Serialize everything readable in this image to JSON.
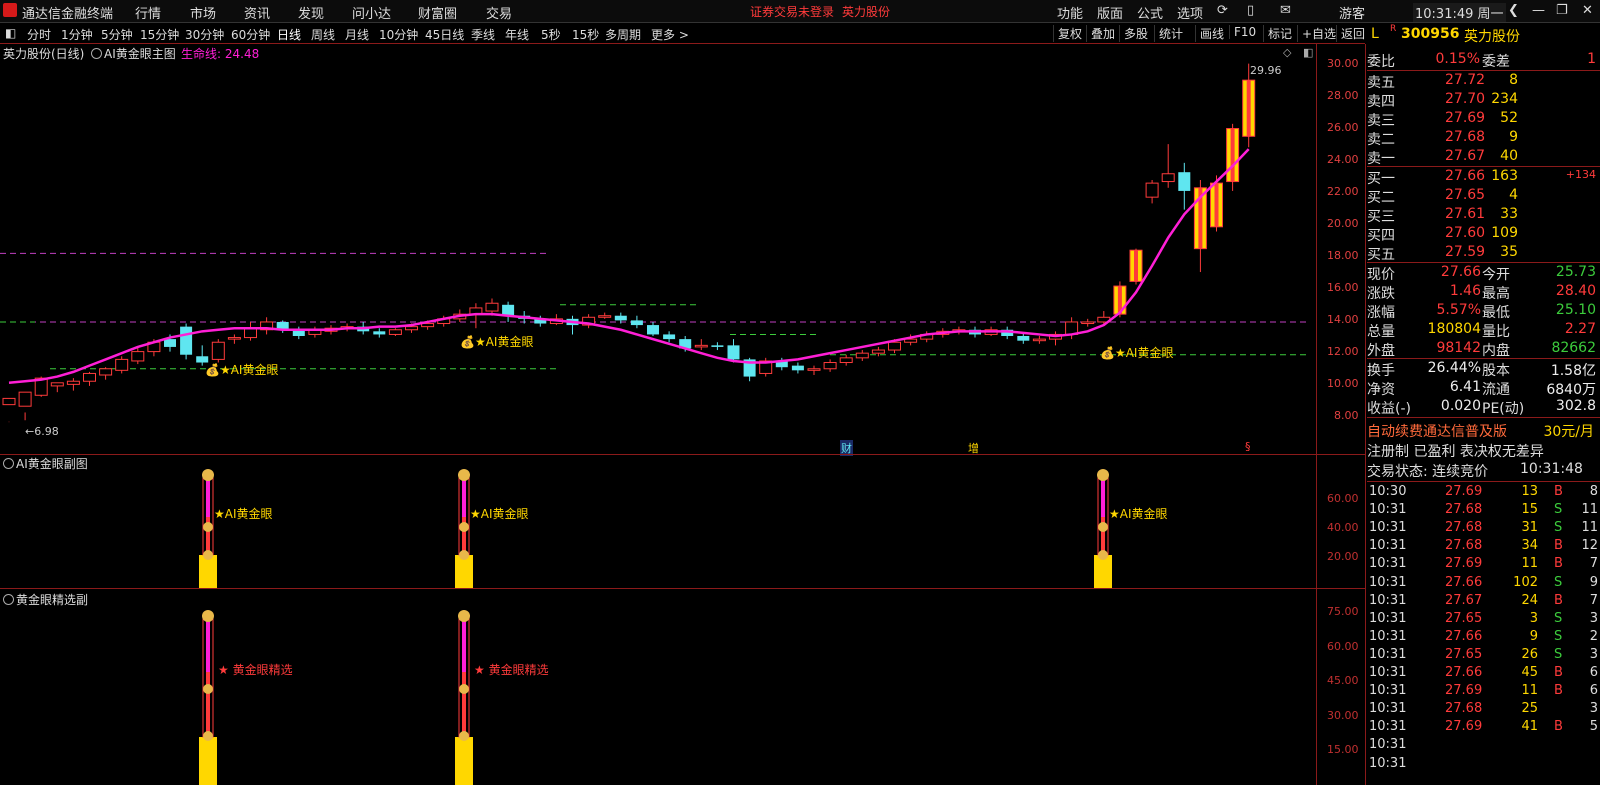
{
  "app": {
    "title": "通达信金融终端"
  },
  "menu": {
    "items": [
      "行情",
      "市场",
      "资讯",
      "发现",
      "问小达",
      "财富圈",
      "交易"
    ],
    "warning": "证券交易未登录",
    "stock_name": "英力股份",
    "right_items": [
      "功能",
      "版面",
      "公式",
      "选项"
    ],
    "user": "游客",
    "clock": "10:31:49 周一"
  },
  "periods": [
    "分时",
    "1分钟",
    "5分钟",
    "15分钟",
    "30分钟",
    "60分钟",
    "日线",
    "周线",
    "月线",
    "10分钟",
    "45日线",
    "季线",
    "年线",
    "5秒",
    "15秒",
    "多周期",
    "更多 >"
  ],
  "tools": [
    "复权",
    "叠加",
    "多股",
    "统计",
    "画线",
    "F10",
    "标记",
    "+自选",
    "返回"
  ],
  "main_panel": {
    "title": "英力股份(日线)",
    "indicator": "AI黄金眼主图",
    "lifeline_label": "生命线: 24.48",
    "y_ticks": [
      "30.00",
      "28.00",
      "26.00",
      "24.00",
      "22.00",
      "20.00",
      "18.00",
      "16.00",
      "14.00",
      "12.00",
      "10.00",
      "8.00"
    ],
    "high_label": "29.96",
    "low_label": "6.98",
    "signal_label": "AI黄金眼",
    "markers": [
      "财",
      "增",
      "§"
    ]
  },
  "sub1": {
    "title": "AI黄金眼副图",
    "y_ticks": [
      "60.00",
      "40.00",
      "20.00"
    ],
    "signal_label": "AI黄金眼"
  },
  "sub2": {
    "title": "黄金眼精选副",
    "y_ticks": [
      "75.00",
      "60.00",
      "45.00",
      "30.00",
      "15.00"
    ],
    "signal_label": "黄金眼精选"
  },
  "quote": {
    "market": "L",
    "r_badge": "R",
    "code": "300956",
    "name": "英力股份",
    "weibi_label": "委比",
    "weibi": "0.15%",
    "weicha_label": "委差",
    "weicha": "1",
    "sell": [
      {
        "label": "卖五",
        "price": "27.72",
        "vol": "8"
      },
      {
        "label": "卖四",
        "price": "27.70",
        "vol": "234"
      },
      {
        "label": "卖三",
        "price": "27.69",
        "vol": "52"
      },
      {
        "label": "卖二",
        "price": "27.68",
        "vol": "9"
      },
      {
        "label": "卖一",
        "price": "27.67",
        "vol": "40"
      }
    ],
    "buy": [
      {
        "label": "买一",
        "price": "27.66",
        "vol": "163",
        "chg": "+134"
      },
      {
        "label": "买二",
        "price": "27.65",
        "vol": "4",
        "chg": ""
      },
      {
        "label": "买三",
        "price": "27.61",
        "vol": "33",
        "chg": ""
      },
      {
        "label": "买四",
        "price": "27.60",
        "vol": "109",
        "chg": ""
      },
      {
        "label": "买五",
        "price": "27.59",
        "vol": "35",
        "chg": ""
      }
    ],
    "stats": [
      {
        "l1": "现价",
        "v1": "27.66",
        "l2": "今开",
        "v2": "25.73",
        "c1": "red",
        "c2": "green"
      },
      {
        "l1": "涨跌",
        "v1": "1.46",
        "l2": "最高",
        "v2": "28.40",
        "c1": "red",
        "c2": "red"
      },
      {
        "l1": "涨幅",
        "v1": "5.57%",
        "l2": "最低",
        "v2": "25.10",
        "c1": "red",
        "c2": "green"
      },
      {
        "l1": "总量",
        "v1": "180804",
        "l2": "量比",
        "v2": "2.27",
        "c1": "yellow",
        "c2": "red"
      },
      {
        "l1": "外盘",
        "v1": "98142",
        "l2": "内盘",
        "v2": "82662",
        "c1": "red",
        "c2": "green"
      }
    ],
    "stats2": [
      {
        "l1": "换手",
        "v1": "26.44%",
        "l2": "股本",
        "v2": "1.58亿"
      },
      {
        "l1": "净资",
        "v1": "6.41",
        "l2": "流通",
        "v2": "6840万"
      },
      {
        "l1": "收益(-)",
        "v1": "0.020",
        "l2": "PE(动)",
        "v2": "302.8"
      }
    ],
    "ad1": "自动续费通达信普及版",
    "ad1_price": "30元/月",
    "ad2": "注册制 已盈利 表决权无差异",
    "status_label": "交易状态: 连续竞价",
    "status_time": "10:31:48",
    "ticks": [
      {
        "t": "10:30",
        "p": "27.69",
        "v": "13",
        "s": "B",
        "n": "8"
      },
      {
        "t": "10:31",
        "p": "27.68",
        "v": "15",
        "s": "S",
        "n": "11"
      },
      {
        "t": "10:31",
        "p": "27.68",
        "v": "31",
        "s": "S",
        "n": "11"
      },
      {
        "t": "10:31",
        "p": "27.68",
        "v": "34",
        "s": "B",
        "n": "12"
      },
      {
        "t": "10:31",
        "p": "27.69",
        "v": "11",
        "s": "B",
        "n": "7"
      },
      {
        "t": "10:31",
        "p": "27.66",
        "v": "102",
        "s": "S",
        "n": "9"
      },
      {
        "t": "10:31",
        "p": "27.67",
        "v": "24",
        "s": "B",
        "n": "7"
      },
      {
        "t": "10:31",
        "p": "27.65",
        "v": "3",
        "s": "S",
        "n": "3"
      },
      {
        "t": "10:31",
        "p": "27.66",
        "v": "9",
        "s": "S",
        "n": "2"
      },
      {
        "t": "10:31",
        "p": "27.65",
        "v": "26",
        "s": "S",
        "n": "3"
      },
      {
        "t": "10:31",
        "p": "27.66",
        "v": "45",
        "s": "B",
        "n": "6"
      },
      {
        "t": "10:31",
        "p": "27.69",
        "v": "11",
        "s": "B",
        "n": "6"
      },
      {
        "t": "10:31",
        "p": "27.68",
        "v": "25",
        "s": "",
        "n": "3"
      },
      {
        "t": "10:31",
        "p": "27.69",
        "v": "41",
        "s": "B",
        "n": "5"
      },
      {
        "t": "10:31",
        "p": "",
        "v": "",
        "s": "",
        "n": ""
      },
      {
        "t": "10:31",
        "p": "",
        "v": "",
        "s": "",
        "n": ""
      }
    ]
  },
  "colors": {
    "up": "#ff3b3b",
    "down": "#3ccc3c",
    "cyan": "#5fe6f0",
    "magenta": "#ff1fd6",
    "gold": "#ffd700",
    "border": "#8b1a1a"
  },
  "chart_data": {
    "type": "candlestick",
    "ylim": [
      6.5,
      31
    ],
    "candles": [
      [
        8.1,
        8.5,
        7.0,
        6.98
      ],
      [
        8.0,
        8.9,
        7.1,
        7.6
      ],
      [
        8.7,
        9.8,
        8.6,
        9.9
      ],
      [
        9.3,
        9.5,
        8.9,
        9.4
      ],
      [
        9.4,
        9.6,
        9.0,
        9.8
      ],
      [
        9.6,
        10.1,
        9.3,
        10.2
      ],
      [
        10.0,
        10.4,
        9.7,
        10.5
      ],
      [
        10.3,
        11.0,
        10.1,
        11.2
      ],
      [
        10.9,
        11.5,
        10.7,
        11.8
      ],
      [
        11.5,
        12.1,
        11.2,
        12.3
      ],
      [
        12.3,
        11.8,
        11.5,
        12.6
      ],
      [
        13.1,
        11.3,
        11.0,
        13.3
      ],
      [
        11.2,
        10.8,
        10.6,
        11.9
      ],
      [
        11.0,
        12.1,
        10.8,
        12.3
      ],
      [
        12.3,
        12.4,
        12.0,
        12.6
      ],
      [
        12.4,
        13.0,
        12.2,
        13.4
      ],
      [
        12.9,
        13.4,
        12.6,
        13.7
      ],
      [
        13.4,
        12.9,
        12.7,
        13.5
      ],
      [
        12.9,
        12.5,
        12.3,
        13.1
      ],
      [
        12.6,
        12.9,
        12.4,
        13.1
      ],
      [
        12.8,
        13.0,
        12.6,
        13.2
      ],
      [
        13.0,
        13.1,
        12.8,
        13.3
      ],
      [
        13.1,
        12.8,
        12.6,
        13.4
      ],
      [
        12.8,
        12.6,
        12.4,
        13.0
      ],
      [
        12.6,
        12.9,
        12.5,
        13.0
      ],
      [
        12.9,
        13.1,
        12.7,
        13.3
      ],
      [
        13.1,
        13.3,
        12.9,
        13.5
      ],
      [
        13.3,
        13.6,
        13.1,
        13.8
      ],
      [
        13.6,
        13.9,
        13.4,
        14.2
      ],
      [
        13.9,
        14.3,
        13.0,
        14.6
      ],
      [
        14.1,
        14.6,
        13.8,
        14.9
      ],
      [
        14.5,
        13.8,
        13.4,
        14.7
      ],
      [
        13.8,
        13.6,
        13.3,
        14.1
      ],
      [
        13.6,
        13.3,
        13.1,
        13.8
      ],
      [
        13.3,
        13.6,
        13.2,
        13.9
      ],
      [
        13.6,
        13.2,
        12.6,
        13.8
      ],
      [
        13.2,
        13.7,
        13.0,
        13.9
      ],
      [
        13.7,
        13.8,
        13.6,
        14.0
      ],
      [
        13.8,
        13.5,
        13.3,
        14.0
      ],
      [
        13.5,
        13.2,
        13.0,
        13.8
      ],
      [
        13.2,
        12.6,
        12.5,
        13.4
      ],
      [
        12.6,
        12.3,
        12.1,
        12.8
      ],
      [
        12.3,
        11.7,
        11.5,
        12.5
      ],
      [
        11.8,
        11.9,
        11.6,
        12.3
      ],
      [
        11.9,
        11.8,
        11.6,
        12.1
      ],
      [
        11.9,
        11.0,
        10.8,
        12.3
      ],
      [
        11.0,
        9.9,
        9.6,
        11.1
      ],
      [
        10.1,
        10.9,
        9.9,
        11.1
      ],
      [
        10.9,
        10.5,
        10.3,
        11.1
      ],
      [
        10.6,
        10.3,
        10.1,
        10.8
      ],
      [
        10.3,
        10.4,
        10.0,
        10.6
      ],
      [
        10.4,
        10.8,
        10.2,
        11.0
      ],
      [
        10.8,
        11.1,
        10.6,
        11.3
      ],
      [
        11.1,
        11.4,
        10.9,
        11.6
      ],
      [
        11.4,
        11.6,
        11.2,
        11.8
      ],
      [
        11.6,
        12.1,
        11.4,
        12.3
      ],
      [
        12.1,
        12.3,
        11.9,
        12.6
      ],
      [
        12.3,
        12.6,
        12.1,
        12.8
      ],
      [
        12.6,
        12.8,
        12.4,
        13.0
      ],
      [
        12.8,
        12.9,
        12.6,
        13.1
      ],
      [
        12.9,
        12.6,
        12.4,
        13.1
      ],
      [
        12.6,
        12.9,
        12.5,
        13.1
      ],
      [
        12.9,
        12.5,
        12.3,
        13.1
      ],
      [
        12.5,
        12.2,
        12.0,
        12.7
      ],
      [
        12.2,
        12.3,
        12.0,
        12.5
      ],
      [
        12.3,
        12.6,
        11.9,
        12.8
      ],
      [
        12.6,
        13.4,
        12.3,
        13.7
      ],
      [
        13.3,
        13.4,
        13.1,
        13.6
      ],
      [
        13.4,
        13.7,
        13.2,
        14.1
      ],
      [
        13.9,
        15.7,
        13.7,
        16.0
      ],
      [
        16.0,
        18.0,
        15.8,
        18.1
      ],
      [
        21.4,
        22.3,
        21.0,
        22.5
      ],
      [
        22.4,
        22.9,
        22.0,
        24.8
      ],
      [
        23.0,
        21.8,
        20.6,
        23.6
      ],
      [
        18.1,
        22.0,
        16.6,
        22.5
      ],
      [
        19.5,
        22.3,
        19.2,
        22.8
      ],
      [
        22.4,
        25.8,
        21.8,
        26.1
      ],
      [
        25.3,
        28.9,
        24.6,
        29.96
      ]
    ],
    "lifeline": [
      9.5,
      9.6,
      9.7,
      9.9,
      10.2,
      10.6,
      11.0,
      11.4,
      11.8,
      12.1,
      12.4,
      12.6,
      12.8,
      12.9,
      13.0,
      13.0,
      13.0,
      12.9,
      12.9,
      12.9,
      12.9,
      13.0,
      13.0,
      13.1,
      13.1,
      13.2,
      13.4,
      13.6,
      13.8,
      13.9,
      13.9,
      13.8,
      13.7,
      13.6,
      13.5,
      13.4,
      13.3,
      13.1,
      12.9,
      12.6,
      12.3,
      12.0,
      11.7,
      11.4,
      11.1,
      10.9,
      10.8,
      10.8,
      10.9,
      11.0,
      11.2,
      11.4,
      11.6,
      11.8,
      12.0,
      12.2,
      12.4,
      12.6,
      12.7,
      12.8,
      12.8,
      12.8,
      12.8,
      12.7,
      12.6,
      12.5,
      12.6,
      12.8,
      13.2,
      14.0,
      15.3,
      17.0,
      18.8,
      20.3,
      21.4,
      22.4,
      23.4,
      24.48
    ]
  }
}
